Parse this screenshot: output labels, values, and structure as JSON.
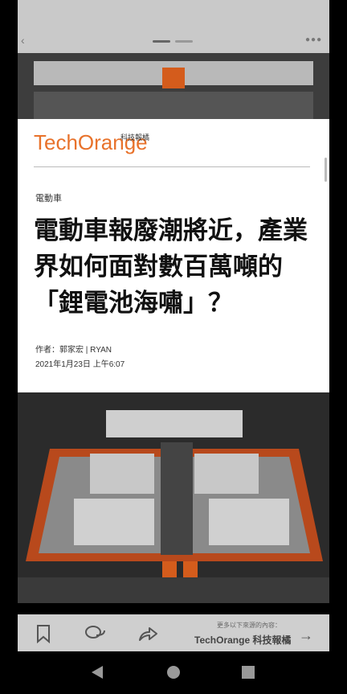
{
  "header": {
    "back_glyph": "‹",
    "more_glyph": "●●●"
  },
  "article": {
    "logo_text": "TechOrange",
    "logo_sub": "科技報橘",
    "category": "電動車",
    "title": "電動車報廢潮將近，產業界如何面對數百萬噸的「鋰電池海嘯」？",
    "author": "作者：郭家宏 | RYAN",
    "date": "2021年1月23日 上午6:07"
  },
  "footer": {
    "more_label": "更多以下來源的內容：",
    "source_name": "TechOrange 科技報橘",
    "arrow_glyph": "→"
  },
  "colors": {
    "brand_orange": "#e8722b",
    "battery_frame": "#b8491c"
  }
}
